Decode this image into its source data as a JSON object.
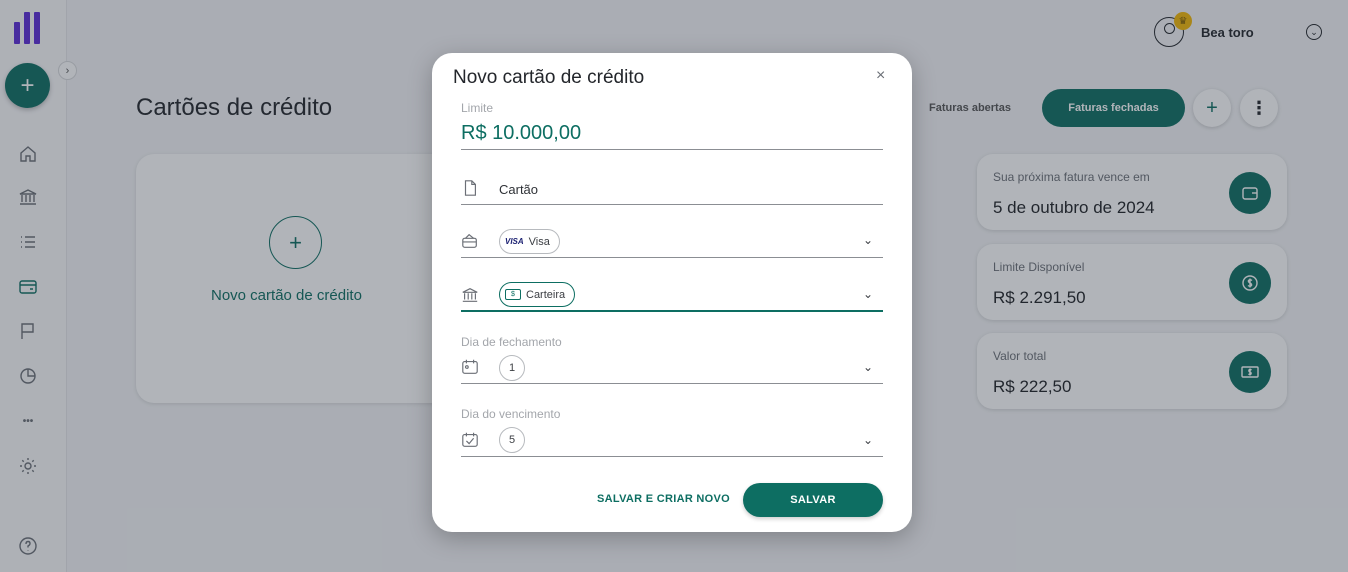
{
  "sidebar": {
    "add_label": "+",
    "collapse_label": "›",
    "more_label": "•••"
  },
  "header": {
    "page_title": "Cartões de crédito",
    "user_name": "Bea toro",
    "crown_icon": "♛",
    "caret_icon": "⌄"
  },
  "tabs": {
    "open_label": "Faturas abertas",
    "closed_label": "Faturas fechadas",
    "add_label": "+",
    "more_label": "⋮"
  },
  "new_card": {
    "plus": "+",
    "label": "Novo cartão de crédito"
  },
  "summary": [
    {
      "label": "Sua próxima fatura vence em",
      "value": "5 de outubro de 2024",
      "icon": "wallet-icon"
    },
    {
      "label": "Limite Disponível",
      "value": "R$ 2.291,50",
      "icon": "coin-icon"
    },
    {
      "label": "Valor total",
      "value": "R$ 222,50",
      "icon": "cash-icon"
    }
  ],
  "modal": {
    "title": "Novo cartão de crédito",
    "close": "×",
    "limit_label": "Limite",
    "limit_value": "R$ 10.000,00",
    "name_value": "Cartão",
    "brand_mark": "VISA",
    "brand_value": "Visa",
    "account_mark": "$",
    "account_value": "Carteira",
    "closing_label": "Dia de fechamento",
    "closing_value": "1",
    "due_label": "Dia do vencimento",
    "due_value": "5",
    "caret": "⌄",
    "save_new_label": "SALVAR E CRIAR NOVO",
    "save_label": "SALVAR"
  },
  "colors": {
    "accent": "#0d6e62",
    "brand": "#5b2bd6",
    "crown": "#f2b705"
  }
}
